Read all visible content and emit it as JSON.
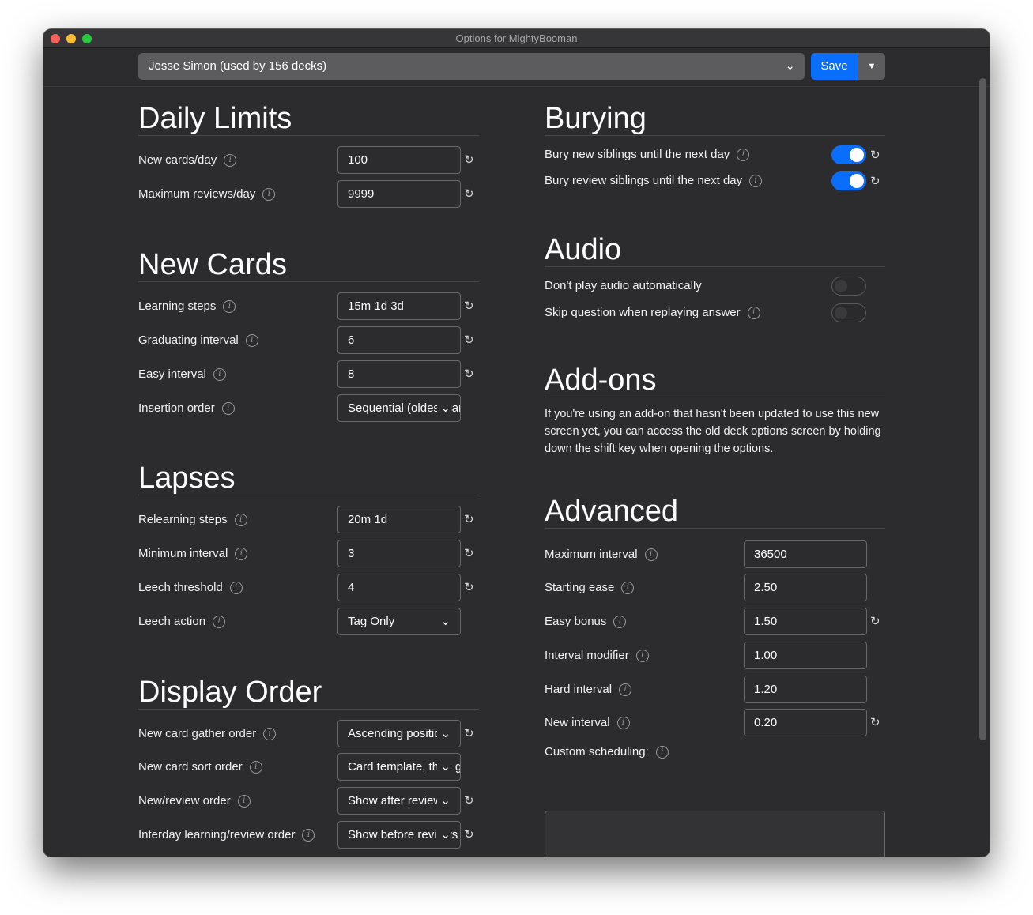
{
  "window": {
    "title": "Options for MightyBooman"
  },
  "topbar": {
    "preset_label": "Jesse Simon (used by 156 decks)",
    "save_label": "Save",
    "save_dropdown_icon": "triangle-down-icon"
  },
  "icons": {
    "info": "i",
    "reset": "↻",
    "chevron": "⌄"
  },
  "daily_limits": {
    "title": "Daily Limits",
    "rows": [
      {
        "label": "New cards/day",
        "value": "100"
      },
      {
        "label": "Maximum reviews/day",
        "value": "9999"
      }
    ]
  },
  "new_cards": {
    "title": "New Cards",
    "rows": [
      {
        "label": "Learning steps",
        "value": "15m 1d 3d"
      },
      {
        "label": "Graduating interval",
        "value": "6"
      },
      {
        "label": "Easy interval",
        "value": "8"
      },
      {
        "label": "Insertion order",
        "value": "Sequential (oldest cards first)"
      }
    ]
  },
  "lapses": {
    "title": "Lapses",
    "rows": [
      {
        "label": "Relearning steps",
        "value": "20m 1d"
      },
      {
        "label": "Minimum interval",
        "value": "3"
      },
      {
        "label": "Leech threshold",
        "value": "4"
      },
      {
        "label": "Leech action",
        "value": "Tag Only"
      }
    ]
  },
  "display_order": {
    "title": "Display Order",
    "rows": [
      {
        "label": "New card gather order",
        "value": "Ascending position"
      },
      {
        "label": "New card sort order",
        "value": "Card template, then gather order"
      },
      {
        "label": "New/review order",
        "value": "Show after reviews"
      },
      {
        "label": "Interday learning/review order",
        "value": "Show before reviews"
      }
    ]
  },
  "burying": {
    "title": "Burying",
    "rows": [
      {
        "label": "Bury new siblings until the next day",
        "state": "on"
      },
      {
        "label": "Bury review siblings until the next day",
        "state": "on"
      }
    ]
  },
  "audio": {
    "title": "Audio",
    "rows": [
      {
        "label": "Don't play audio automatically",
        "state": "off"
      },
      {
        "label": "Skip question when replaying answer",
        "state": "off"
      }
    ]
  },
  "addons": {
    "title": "Add-ons",
    "text": "If you're using an add-on that hasn't been updated to use this new screen yet, you can access the old deck options screen by holding down the shift key when opening the options."
  },
  "advanced": {
    "title": "Advanced",
    "rows": [
      {
        "label": "Maximum interval",
        "value": "36500"
      },
      {
        "label": "Starting ease",
        "value": "2.50"
      },
      {
        "label": "Easy bonus",
        "value": "1.50"
      },
      {
        "label": "Interval modifier",
        "value": "1.00"
      },
      {
        "label": "Hard interval",
        "value": "1.20"
      },
      {
        "label": "New interval",
        "value": "0.20"
      }
    ],
    "custom_label": "Custom scheduling:"
  },
  "colors": {
    "accent": "#0a6efd",
    "background": "#2c2c2e",
    "field_border": "#6a6a6c"
  }
}
